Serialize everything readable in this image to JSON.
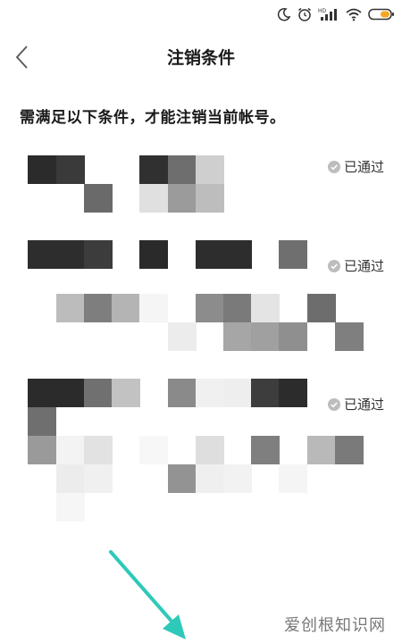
{
  "status_bar": {
    "icons": [
      "moon-icon",
      "alarm-icon",
      "signal-hd-icon",
      "wifi-icon",
      "battery-icon"
    ],
    "hd_label": "HD"
  },
  "header": {
    "title": "注销条件",
    "back_icon": "chevron-left-icon"
  },
  "instruction": "需满足以下条件，才能注销当前帐号。",
  "conditions": [
    {
      "status": "已通过"
    },
    {
      "status": "已通过"
    },
    {
      "status": "已通过"
    }
  ],
  "colors": {
    "accent_arrow": "#2ec9b9",
    "check_icon": "#bdbdbd"
  },
  "watermark": "爱创根知识网"
}
